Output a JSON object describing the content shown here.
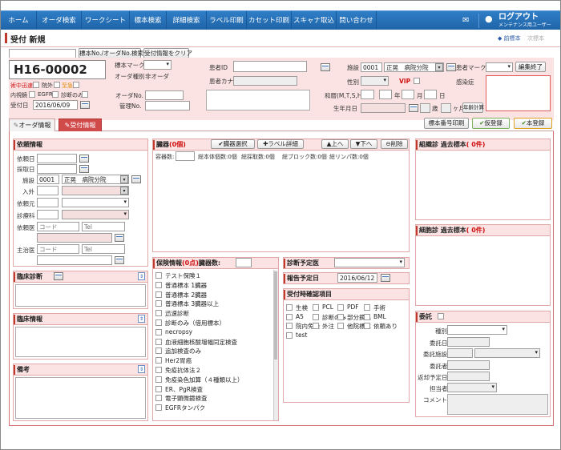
{
  "nav": {
    "items": [
      "ホーム",
      "オーダ検索",
      "ワークシート",
      "標本検索",
      "詳細検索",
      "ラベル印刷",
      "カセット印刷",
      "スキャナ取込",
      "問い合わせ"
    ],
    "logout": "ログアウト",
    "user": "メンテナンス用ユーザー"
  },
  "page": {
    "title": "受付 新規",
    "prev": "◆ 前標本",
    "next": "次標本"
  },
  "search_row": {
    "btn_no_search": "標本No./オーダNo.検索",
    "btn_clear": "受付情報をクリア"
  },
  "specimen": {
    "number": "H16-00002",
    "mark_label": "標本マーク",
    "order_type_label": "オーダ種別",
    "order_type_value": "非オーダ",
    "flags": [
      "術中迅速",
      "院外",
      "至急",
      "内視鏡",
      "EGFR",
      "診断のみ"
    ],
    "reception_date_label": "受付日",
    "reception_date": "2016/06/09",
    "order_no_label": "オーダNo.",
    "manage_no_label": "管理No."
  },
  "patient": {
    "id_label": "患者ID",
    "kana_label": "患者カナ",
    "facility_label": "施設",
    "facility_code": "0001",
    "facility_name": "正晃　病院分院",
    "patient_mark_label": "患者マーク",
    "edit_end": "編集終了",
    "sex_label": "性別",
    "vip": "VIP",
    "infection_label": "感染症",
    "era_label": "和暦(M,T,S,H)",
    "year": "年",
    "month": "月",
    "day": "日",
    "birth_label": "生年月日",
    "age": "歳",
    "months": "ヶ月",
    "age_calc": "年齢計算"
  },
  "tabs": {
    "order_info": "オーダ情報",
    "reception_info": "受付情報"
  },
  "actions": {
    "print_no": "標本番号印刷",
    "temp_register": "仮登録",
    "register": "本登録"
  },
  "request": {
    "title": "依頼情報",
    "request_date": "依頼日",
    "collect_date": "採取日",
    "facility": "施設",
    "facility_code": "0001",
    "facility_name": "正晃　病院分院",
    "ward": "入外",
    "requester": "依頼元",
    "dept": "診療科",
    "doctor": "依頼医",
    "code_ph": "コード",
    "tel_ph": "Tel",
    "attending": "主治医"
  },
  "clinical_diag": {
    "title": "臨床診断"
  },
  "clinical_info": {
    "title": "臨床情報"
  },
  "remarks": {
    "title": "備考"
  },
  "organs": {
    "title": "臓器",
    "count": "(0個)",
    "select": "臓器選択",
    "label_detail": "ラベル詳細",
    "up": "上へ",
    "down": "下へ",
    "delete": "削除",
    "container": "容器数:",
    "summary": [
      "総本体個数:0個",
      "総採取数:0個",
      "総ブロック数:0個",
      "総リンパ数:0個"
    ]
  },
  "insurance": {
    "title": "保険情報",
    "count": "(0点)",
    "organ_count": "臓器数:",
    "items": [
      "テスト保険１",
      "普通標本 1臓器",
      "普通標本 2臓器",
      "普通標本 3臓器以上",
      "迅速診断",
      "診断のみ（借用標本）",
      "necropsy",
      "血液細胞核酸増幅同定検査",
      "追加検査のみ",
      "Her2胃癌",
      "免疫抗体法２",
      "免疫染色加算（４種類以上）",
      "ER、PgR検査",
      "電子顕微鏡検査",
      "EGFRタンパク"
    ]
  },
  "diag_doctor": {
    "title": "診断予定医"
  },
  "report_date": {
    "title": "報告予定日",
    "value": "2016/06/12"
  },
  "confirm": {
    "title": "受付時確認項目",
    "items": [
      "生検",
      "PCL",
      "PDF",
      "手術",
      "A5",
      "診断のみ",
      "部分摘出",
      "BML",
      "院内免染",
      "外注",
      "他院標本",
      "依頼あり",
      "test"
    ]
  },
  "histo_past": {
    "title": "組織診 過去標本",
    "count": "( 0件)"
  },
  "cyto_past": {
    "title": "細胞診 過去標本",
    "count": "( 0件)"
  },
  "commission": {
    "title": "委託",
    "fields": [
      "種別",
      "委託日",
      "委託施設",
      "委託者",
      "返却予定日",
      "担当者",
      "コメント"
    ]
  }
}
